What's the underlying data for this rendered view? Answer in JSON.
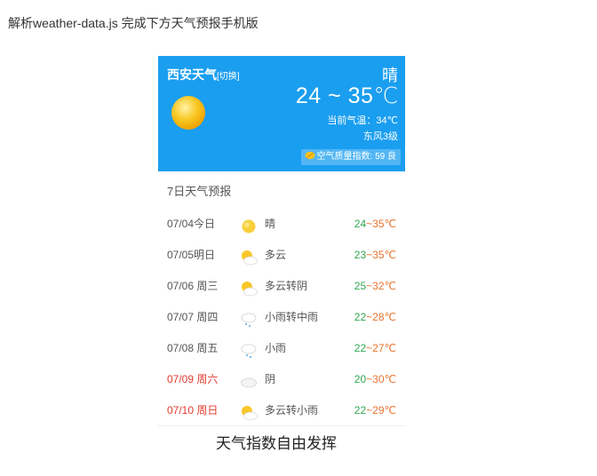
{
  "page_heading": "解析weather-data.js 完成下方天气预报手机版",
  "widget": {
    "city": "西安天气",
    "switch_label": "[切换]",
    "condition": "晴",
    "temp_range": "24 ~ 35℃",
    "current_temp": "当前气温：34℃",
    "wind": "东风3级",
    "aqi": "空气质量指数: 59 良"
  },
  "forecast": {
    "title": "7日天气预报",
    "days": [
      {
        "date": "07/04今日",
        "icon": "sun-icon",
        "desc": "晴",
        "lo": "24",
        "hi": "35℃",
        "weekend": false
      },
      {
        "date": "07/05明日",
        "icon": "partly-cloudy-icon",
        "desc": "多云",
        "lo": "23",
        "hi": "35℃",
        "weekend": false
      },
      {
        "date": "07/06 周三",
        "icon": "partly-cloudy-icon",
        "desc": "多云转阴",
        "lo": "25",
        "hi": "32℃",
        "weekend": false
      },
      {
        "date": "07/07 周四",
        "icon": "rain-icon",
        "desc": "小雨转中雨",
        "lo": "22",
        "hi": "28℃",
        "weekend": false
      },
      {
        "date": "07/08 周五",
        "icon": "rain-icon",
        "desc": "小雨",
        "lo": "22",
        "hi": "27℃",
        "weekend": false
      },
      {
        "date": "07/09 周六",
        "icon": "cloud-icon",
        "desc": "阴",
        "lo": "20",
        "hi": "30℃",
        "weekend": true
      },
      {
        "date": "07/10 周日",
        "icon": "partly-cloudy-icon",
        "desc": "多云转小雨",
        "lo": "22",
        "hi": "29℃",
        "weekend": true
      }
    ]
  },
  "footer_note": "天气指数自由发挥"
}
